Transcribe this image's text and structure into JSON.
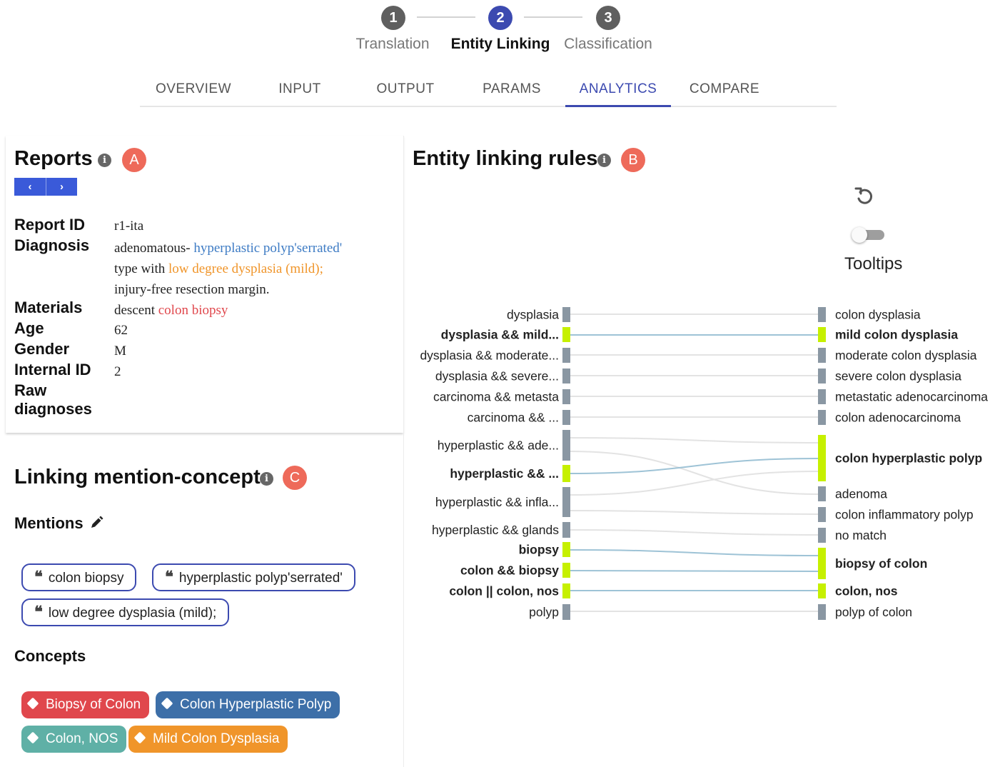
{
  "stepper": {
    "steps": [
      {
        "number": "1",
        "label": "Translation",
        "active": false
      },
      {
        "number": "2",
        "label": "Entity Linking",
        "active": true
      },
      {
        "number": "3",
        "label": "Classification",
        "active": false
      }
    ]
  },
  "tabs": [
    "OVERVIEW",
    "INPUT",
    "OUTPUT",
    "PARAMS",
    "ANALYTICS",
    "COMPARE"
  ],
  "active_tab": "ANALYTICS",
  "colors": {
    "accent": "#3c4ab0",
    "badge": "#ee6a5a",
    "highlight_blue": "#3d7bc4",
    "highlight_orange": "#f0952a",
    "highlight_red": "#e0474c",
    "sankey_selected_node": "#c6f000",
    "sankey_node": "#8a97a3",
    "sankey_selected_link": "#9ec3d6",
    "sankey_link": "#e3e3e3"
  },
  "reports": {
    "title": "Reports",
    "badge": "A",
    "prev_label": "‹",
    "next_label": "›",
    "fields": {
      "report_id_label": "Report ID",
      "report_id": "r1-ita",
      "diagnosis_label": "Diagnosis",
      "diagnosis_line1_plain": "adenomatous- ",
      "diagnosis_line1_highlight": "hyperplastic polyp'serrated'",
      "diagnosis_line2_plain": "type with ",
      "diagnosis_line2_highlight": "low degree dysplasia (mild);",
      "diagnosis_line3": "injury-free resection margin.",
      "materials_label": "Materials",
      "materials_plain": "descent ",
      "materials_highlight": "colon biopsy",
      "age_label": "Age",
      "age": "62",
      "gender_label": "Gender",
      "gender": "M",
      "internal_id_label": "Internal ID",
      "internal_id": "2",
      "raw_diagnoses_label_line1": "Raw",
      "raw_diagnoses_label_line2": "diagnoses"
    }
  },
  "linking": {
    "title": "Linking mention-concept",
    "badge": "C",
    "mentions_label": "Mentions",
    "quote_glyph": "❝",
    "mentions": [
      "colon biopsy",
      "hyperplastic polyp'serrated'",
      "low degree dysplasia (mild);"
    ],
    "concepts_label": "Concepts",
    "concepts": [
      {
        "label": "Biopsy of Colon",
        "color": "#e0474c"
      },
      {
        "label": "Colon Hyperplastic Polyp",
        "color": "#3d6fa8"
      },
      {
        "label": "Colon, NOS",
        "color": "#5fb0a6"
      },
      {
        "label": "Mild Colon Dysplasia",
        "color": "#f0952a"
      }
    ]
  },
  "rules": {
    "title": "Entity linking rules",
    "badge": "B",
    "tooltips_label": "Tooltips",
    "tooltips_enabled": false
  },
  "sankey": {
    "left_nodes": [
      {
        "label": "dysplasia",
        "selected": false
      },
      {
        "label": "dysplasia && mild...",
        "selected": true
      },
      {
        "label": "dysplasia && moderate...",
        "selected": false
      },
      {
        "label": "dysplasia && severe...",
        "selected": false
      },
      {
        "label": "carcinoma && metasta",
        "selected": false
      },
      {
        "label": "carcinoma && ...",
        "selected": false
      },
      {
        "label": "hyperplastic && ade...",
        "selected": false
      },
      {
        "label": "hyperplastic && ...",
        "selected": true
      },
      {
        "label": "hyperplastic && infla...",
        "selected": false
      },
      {
        "label": "hyperplastic && glands",
        "selected": false
      },
      {
        "label": "biopsy",
        "selected": true
      },
      {
        "label": "colon && biopsy",
        "selected": true
      },
      {
        "label": "colon || colon, nos",
        "selected": true
      },
      {
        "label": "polyp",
        "selected": false
      }
    ],
    "right_nodes": [
      {
        "label": "colon dysplasia",
        "selected": false
      },
      {
        "label": "mild colon dysplasia",
        "selected": true
      },
      {
        "label": "moderate colon dysplasia",
        "selected": false
      },
      {
        "label": "severe colon dysplasia",
        "selected": false
      },
      {
        "label": "metastatic adenocarcinoma",
        "selected": false
      },
      {
        "label": "colon adenocarcinoma",
        "selected": false
      },
      {
        "label": "colon hyperplastic polyp",
        "selected": true
      },
      {
        "label": "adenoma",
        "selected": false
      },
      {
        "label": "colon inflammatory polyp",
        "selected": false
      },
      {
        "label": "no match",
        "selected": false
      },
      {
        "label": "biopsy of colon",
        "selected": true
      },
      {
        "label": "colon, nos",
        "selected": true
      },
      {
        "label": "polyp of colon",
        "selected": false
      }
    ],
    "links": [
      {
        "source": 0,
        "target": 0,
        "selected": false
      },
      {
        "source": 1,
        "target": 1,
        "selected": true
      },
      {
        "source": 2,
        "target": 2,
        "selected": false
      },
      {
        "source": 3,
        "target": 3,
        "selected": false
      },
      {
        "source": 4,
        "target": 4,
        "selected": false
      },
      {
        "source": 5,
        "target": 5,
        "selected": false
      },
      {
        "source": 6,
        "target": 6,
        "selected": false
      },
      {
        "source": 6,
        "target": 7,
        "selected": false
      },
      {
        "source": 7,
        "target": 6,
        "selected": true
      },
      {
        "source": 8,
        "target": 6,
        "selected": false
      },
      {
        "source": 8,
        "target": 8,
        "selected": false
      },
      {
        "source": 9,
        "target": 9,
        "selected": false
      },
      {
        "source": 10,
        "target": 10,
        "selected": true
      },
      {
        "source": 11,
        "target": 10,
        "selected": true
      },
      {
        "source": 12,
        "target": 11,
        "selected": true
      },
      {
        "source": 13,
        "target": 12,
        "selected": false
      }
    ]
  }
}
